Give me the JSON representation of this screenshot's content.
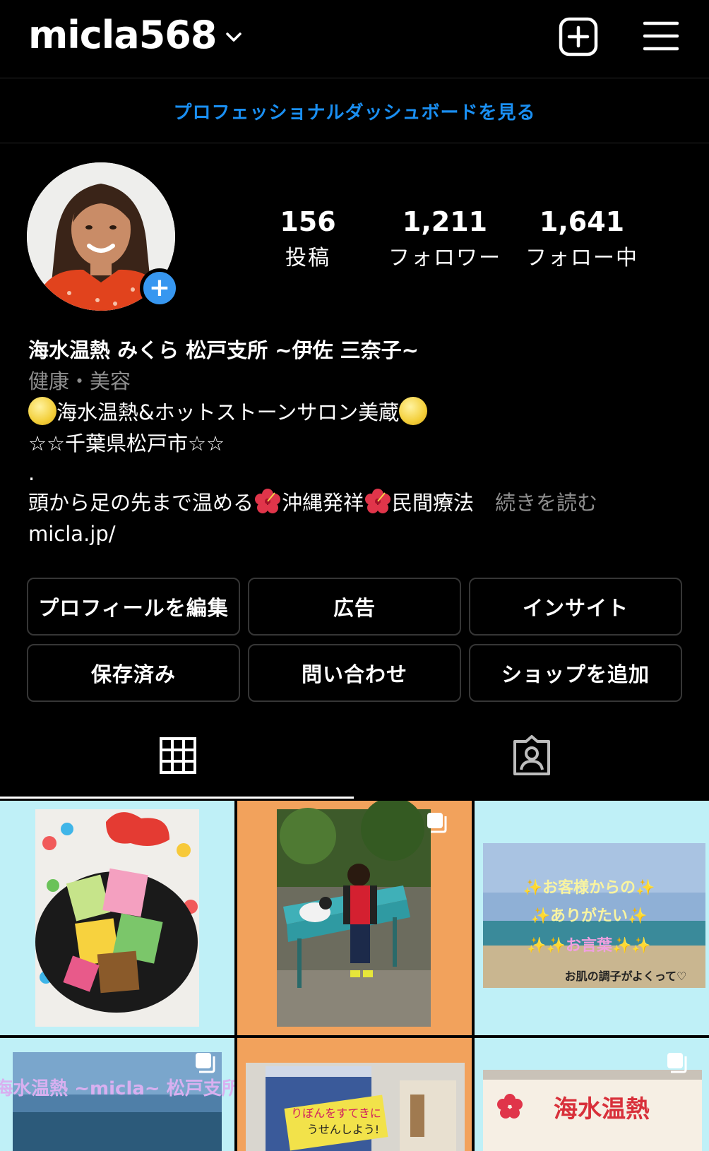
{
  "header": {
    "username": "micla568"
  },
  "dashboard_link": "プロフェッショナルダッシュボードを見る",
  "stats": [
    {
      "value": "156",
      "label": "投稿"
    },
    {
      "value": "1,211",
      "label": "フォロワー"
    },
    {
      "value": "1,641",
      "label": "フォロー中"
    }
  ],
  "bio": {
    "name": "海水温熱 みくら 松戸支所 ~伊佐 三奈子~",
    "category": "健康・美容",
    "line1": "海水温熱&ホットストーンサロン美蔵",
    "line2": "☆☆千葉県松戸市☆☆",
    "line3": ".",
    "line4_a": "頭から足の先まで温める",
    "line4_b": "沖縄発祥",
    "line4_c": "民間療法",
    "more": "続きを読む",
    "link": "micla.jp/"
  },
  "buttons": {
    "edit_profile": "プロフィールを編集",
    "ads": "広告",
    "insights": "インサイト",
    "saved": "保存済み",
    "contact": "問い合わせ",
    "add_shop": "ショップを追加"
  },
  "posts": {
    "post3": {
      "line1": "✨お客様からの✨",
      "line2": "✨ありがたい✨",
      "line3": "✨✨お言葉✨✨",
      "caption": "お肌の調子がよくって♡"
    },
    "post4": {
      "title": "海水温熱 ~micla~ 松戸支所"
    },
    "post5": {
      "text1": "りぼんをすてきに",
      "text2": "うせんしよう!"
    },
    "post6": {
      "title": "海水温熱"
    }
  },
  "colors": {
    "background": "#000000",
    "link_blue": "#1a8ff2",
    "add_badge": "#3797f0",
    "button_border": "#363636",
    "muted_text": "#8e8e8e",
    "tile_light_blue": "#bff0f7",
    "tile_orange": "#f2a25c"
  }
}
